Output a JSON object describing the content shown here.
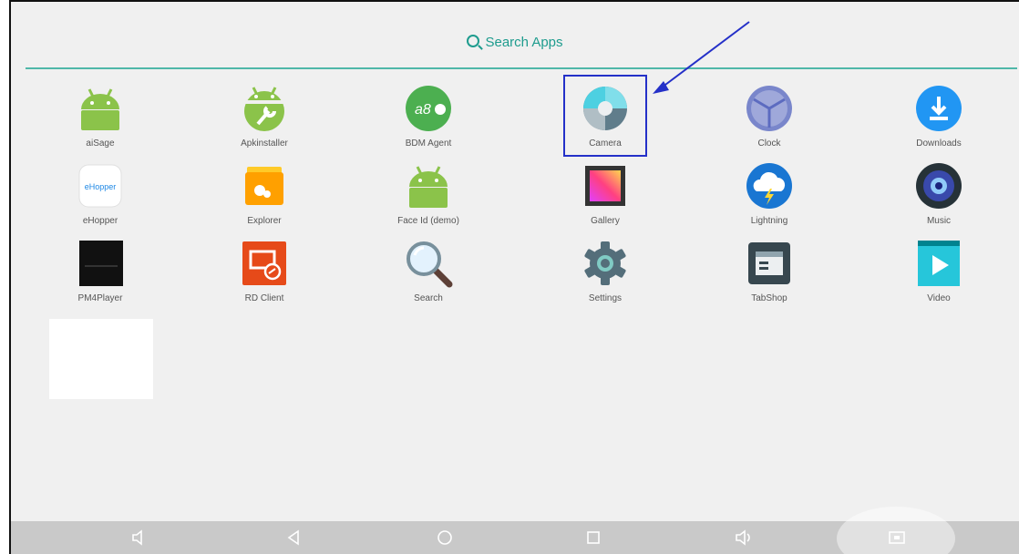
{
  "search": {
    "label": "Search Apps"
  },
  "apps": [
    {
      "label": "aiSage",
      "icon": "android-icon"
    },
    {
      "label": "Apkinstaller",
      "icon": "apk-installer-icon"
    },
    {
      "label": "BDM Agent",
      "icon": "bdm-agent-icon",
      "text": "a8"
    },
    {
      "label": "Camera",
      "icon": "camera-icon"
    },
    {
      "label": "Clock",
      "icon": "clock-icon"
    },
    {
      "label": "Downloads",
      "icon": "download-icon"
    },
    {
      "label": "eHopper",
      "icon": "ehopper-icon",
      "text": "eHopper"
    },
    {
      "label": "Explorer",
      "icon": "folder-icon"
    },
    {
      "label": "Face Id (demo)",
      "icon": "android-icon"
    },
    {
      "label": "Gallery",
      "icon": "gallery-icon"
    },
    {
      "label": "Lightning",
      "icon": "cloud-lightning-icon"
    },
    {
      "label": "Music",
      "icon": "speaker-icon"
    },
    {
      "label": "PM4Player",
      "icon": "pm4player-icon"
    },
    {
      "label": "RD Client",
      "icon": "remote-desktop-icon"
    },
    {
      "label": "Search",
      "icon": "magnifier-icon"
    },
    {
      "label": "Settings",
      "icon": "gear-icon"
    },
    {
      "label": "TabShop",
      "icon": "tabshop-icon"
    },
    {
      "label": "Video",
      "icon": "play-icon"
    }
  ],
  "navbar": [
    "volume-down-icon",
    "back-icon",
    "home-icon",
    "recents-icon",
    "volume-up-icon",
    "screenshot-icon"
  ],
  "colors": {
    "accent": "#1e9c8e",
    "highlight": "#2430c8",
    "navbar": "#c9c9c9"
  }
}
